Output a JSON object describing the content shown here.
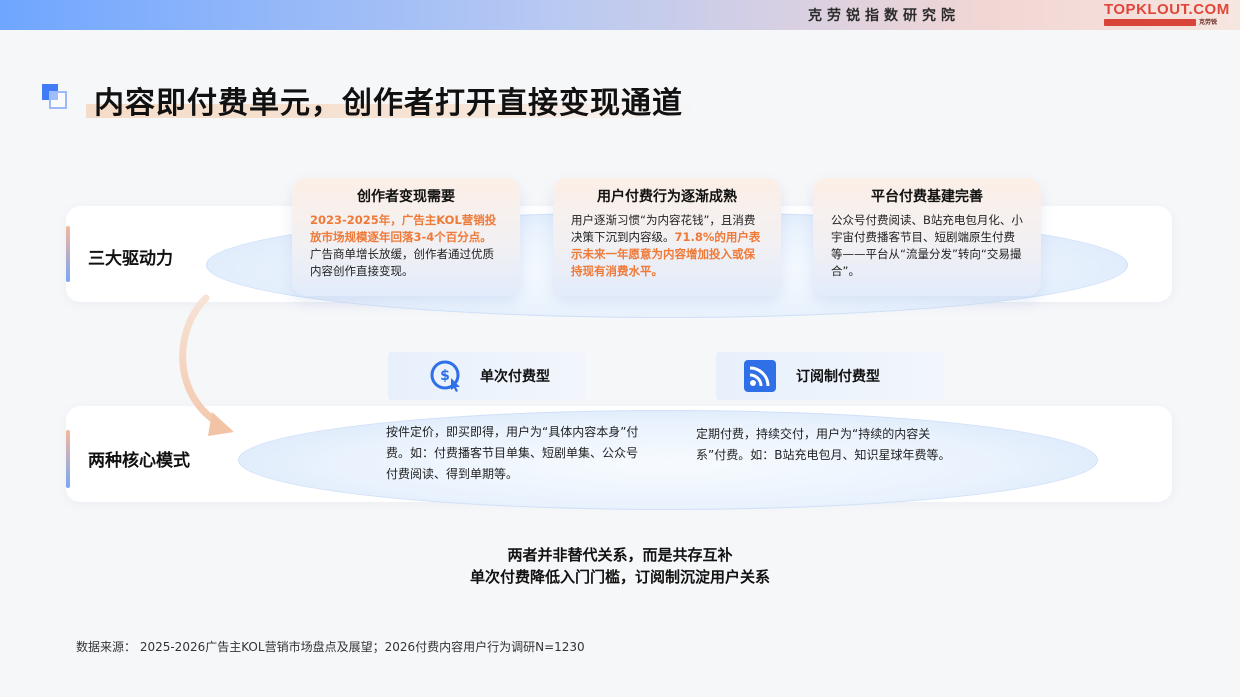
{
  "header": {
    "institute": "克劳锐指数研究院",
    "brand": "TOPKLOUT.COM",
    "brand_sub": "克劳锐"
  },
  "title": "内容即付费单元，创作者打开直接变现通道",
  "rows": {
    "drivers_label": "三大驱动力",
    "modes_label": "两种核心模式"
  },
  "cards": [
    {
      "title": "创作者变现需要",
      "highlight": "2023-2025年，广告主KOL营销投放市场规模逐年回落3-4个百分点。",
      "body": "广告商单增长放缓，创作者通过优质内容创作直接变现。"
    },
    {
      "title": "用户付费行为逐渐成熟",
      "body": "用户逐渐习惯“为内容花钱”，且消费决策下沉到内容级。",
      "highlight": "71.8%的用户表示未来一年愿意为内容增加投入或保持现有消费水平。"
    },
    {
      "title": "平台付费基建完善",
      "body": "公众号付费阅读、B站充电包月化、小宇宙付费播客节目、短剧端原生付费等——平台从“流量分发”转向“交易撮合”。"
    }
  ],
  "modes": [
    {
      "label": "单次付费型",
      "icon": "dollar-click-icon",
      "desc": "按件定价，即买即得，用户为“具体内容本身”付费。如：付费播客节目单集、短剧单集、公众号付费阅读、得到单期等。"
    },
    {
      "label": "订阅制付费型",
      "icon": "rss-icon",
      "desc": "定期付费，持续交付，用户为“持续的内容关系”付费。如：B站充电包月、知识星球年费等。"
    }
  ],
  "conclusion": {
    "line1": "两者并非替代关系，而是共存互补",
    "line2": "单次付费降低入门门槛，订阅制沉淀用户关系"
  },
  "source": "数据来源：  2025-2026广告主KOL营销市场盘点及展望；2026付费内容用户行为调研N=1230",
  "colors": {
    "accent_blue": "#3f7cf5",
    "highlight_orange": "#ef7a38",
    "brand_red": "#e2453a"
  }
}
